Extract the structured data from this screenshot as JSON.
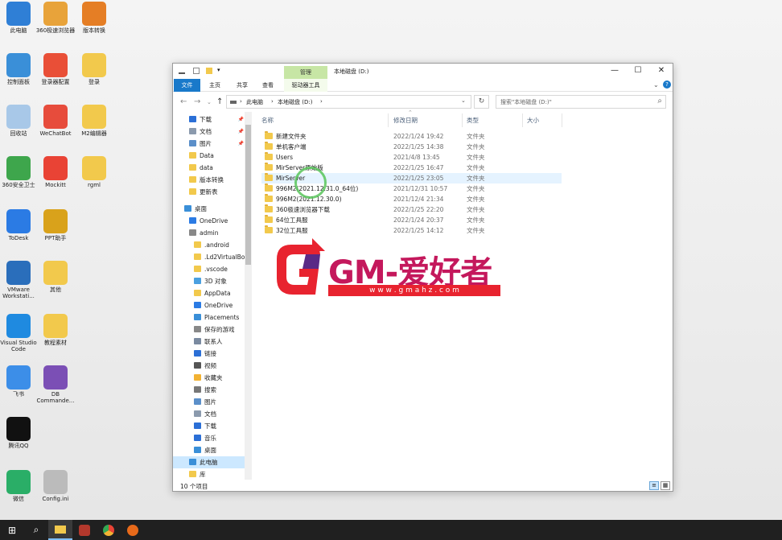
{
  "desktop": {
    "icons": [
      {
        "label": "此电脑",
        "color": "#2f7fd6"
      },
      {
        "label": "360极速浏览器",
        "color": "#e8a33a"
      },
      {
        "label": "版本转换",
        "color": "#e57e25"
      },
      {
        "label": "控制面板",
        "color": "#3a8fd8"
      },
      {
        "label": "登录器配置",
        "color": "#e94f37"
      },
      {
        "label": "登录",
        "color": "#f2c94c"
      },
      {
        "label": "回收站",
        "color": "#a8c8e8"
      },
      {
        "label": "WeChatBot",
        "color": "#e74c3c"
      },
      {
        "label": "M2编辑器",
        "color": "#f2c94c"
      },
      {
        "label": "360安全卫士",
        "color": "#3ea64c"
      },
      {
        "label": "Mockitt",
        "color": "#e94335"
      },
      {
        "label": "rgml",
        "color": "#f2c94c"
      },
      {
        "label": "ToDesk",
        "color": "#2b7be4"
      },
      {
        "label": "PPT助手",
        "color": "#d9a21b"
      },
      {
        "label": "VMware Workstati...",
        "color": "#2a6ebb"
      },
      {
        "label": "其他",
        "color": "#f2c94c"
      },
      {
        "label": "Visual Studio Code",
        "color": "#1f8ae0"
      },
      {
        "label": "教程素材",
        "color": "#f2c94c"
      },
      {
        "label": "飞书",
        "color": "#3c8ee8"
      },
      {
        "label": "DB Commande...",
        "color": "#7b4fb5"
      },
      {
        "label": "腾讯QQ",
        "color": "#111111"
      },
      {
        "label": "微信",
        "color": "#2aae67"
      },
      {
        "label": "Config.ini",
        "color": "#bbbbbb"
      }
    ]
  },
  "window": {
    "context_tab": "管理",
    "title": "本地磁盘 (D:)",
    "controls": {
      "minimize": "—",
      "maximize": "☐",
      "close": "✕"
    },
    "ribbon_tabs": [
      "文件",
      "主页",
      "共享",
      "查看",
      "驱动器工具"
    ],
    "address": {
      "segments": [
        "此电脑",
        "›",
        "本地磁盘 (D:)",
        "›"
      ]
    },
    "search_placeholder": "搜索\"本地磁盘 (D:)\"",
    "nav_items": [
      {
        "label": "下载",
        "color": "#2b6fd6",
        "pin": true
      },
      {
        "label": "文档",
        "color": "#8b9aad",
        "pin": true
      },
      {
        "label": "图片",
        "color": "#5b8fc9",
        "pin": true
      },
      {
        "label": "Data",
        "color": "#f2c94c"
      },
      {
        "label": "data",
        "color": "#f2c94c"
      },
      {
        "label": "版本转换",
        "color": "#f2c94c"
      },
      {
        "label": "更新表",
        "color": "#f2c94c"
      },
      {
        "label": "桌面",
        "color": "#3a8fd8",
        "gap": true
      },
      {
        "label": "OneDrive",
        "color": "#2b7be4"
      },
      {
        "label": "admin",
        "color": "#888888"
      },
      {
        "label": ".android",
        "color": "#f2c94c"
      },
      {
        "label": ".Ld2VirtualBo",
        "color": "#f2c94c"
      },
      {
        "label": ".vscode",
        "color": "#f2c94c"
      },
      {
        "label": "3D 对象",
        "color": "#4aa0e0"
      },
      {
        "label": "AppData",
        "color": "#f2c94c"
      },
      {
        "label": "OneDrive",
        "color": "#2b7be4"
      },
      {
        "label": "Placements",
        "color": "#3a8fd8"
      },
      {
        "label": "保存的游戏",
        "color": "#888888"
      },
      {
        "label": "联系人",
        "color": "#7a8aa0"
      },
      {
        "label": "链接",
        "color": "#2b6fd6"
      },
      {
        "label": "视频",
        "color": "#555555"
      },
      {
        "label": "收藏夹",
        "color": "#f2b233"
      },
      {
        "label": "搜索",
        "color": "#777777"
      },
      {
        "label": "图片",
        "color": "#5b8fc9"
      },
      {
        "label": "文档",
        "color": "#8b9aad"
      },
      {
        "label": "下载",
        "color": "#2b6fd6"
      },
      {
        "label": "音乐",
        "color": "#2b6fd6"
      },
      {
        "label": "桌面",
        "color": "#3a8fd8"
      },
      {
        "label": "此电脑",
        "color": "#3a8fd8",
        "selected": true
      },
      {
        "label": "库",
        "color": "#f2c94c"
      }
    ],
    "columns": [
      "名称",
      "修改日期",
      "类型",
      "大小"
    ],
    "files": [
      {
        "name": "新建文件夹",
        "date": "2022/1/24 19:42",
        "type": "文件夹"
      },
      {
        "name": "单机客户端",
        "date": "2022/1/25 14:38",
        "type": "文件夹"
      },
      {
        "name": "Users",
        "date": "2021/4/8 13:45",
        "type": "文件夹"
      },
      {
        "name": "MirServer原始版",
        "date": "2022/1/25 16:47",
        "type": "文件夹"
      },
      {
        "name": "MirServer",
        "date": "2022/1/25 23:05",
        "type": "文件夹",
        "hover": true
      },
      {
        "name": "996M2(2021.12.31.0_64位)",
        "date": "2021/12/31 10:57",
        "type": "文件夹"
      },
      {
        "name": "996M2(2021.12.30.0)",
        "date": "2021/12/4 21:34",
        "type": "文件夹"
      },
      {
        "name": "360极速浏览器下载",
        "date": "2022/1/25 22:20",
        "type": "文件夹"
      },
      {
        "name": "64位工具服",
        "date": "2022/1/24 20:37",
        "type": "文件夹"
      },
      {
        "name": "32位工具服",
        "date": "2022/1/25 14:12",
        "type": "文件夹"
      }
    ],
    "status": "10 个项目"
  },
  "watermark": {
    "logo_letter": "G",
    "text": "GM-爱好者",
    "url": "w w w . g m a h z . c o m",
    "colors": {
      "red": "#e8232f",
      "purple": "#5a2a86",
      "magenta": "#c4185c"
    }
  },
  "taskbar": {
    "items": [
      "start-icon",
      "search-icon",
      "file-explorer-icon",
      "app-icon",
      "browser-icon",
      "firefox-icon"
    ]
  }
}
